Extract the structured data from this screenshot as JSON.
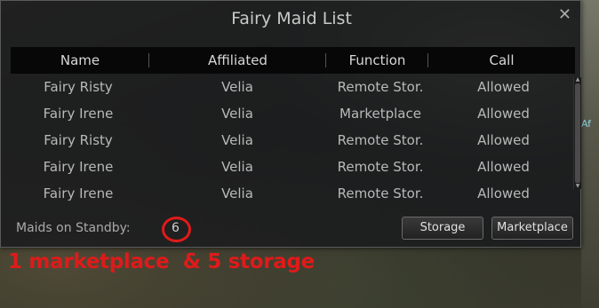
{
  "window": {
    "title": "Fairy Maid List",
    "close_icon": "close-icon"
  },
  "table": {
    "headers": [
      "Name",
      "Affiliated",
      "Function",
      "Call"
    ],
    "rows": [
      [
        "Fairy Risty",
        "Velia",
        "Remote Stor.",
        "Allowed"
      ],
      [
        "Fairy Irene",
        "Velia",
        "Marketplace",
        "Allowed"
      ],
      [
        "Fairy Risty",
        "Velia",
        "Remote Stor.",
        "Allowed"
      ],
      [
        "Fairy Irene",
        "Velia",
        "Remote Stor.",
        "Allowed"
      ],
      [
        "Fairy Irene",
        "Velia",
        "Remote Stor.",
        "Allowed"
      ]
    ]
  },
  "footer": {
    "standby_label": "Maids on Standby:",
    "standby_count": "6",
    "storage_button": "Storage",
    "marketplace_button": "Marketplace"
  },
  "annotation": {
    "text": "1 marketplace  & 5 storage",
    "color": "#e01a1a"
  },
  "scene": {
    "edge_text": "Af"
  }
}
